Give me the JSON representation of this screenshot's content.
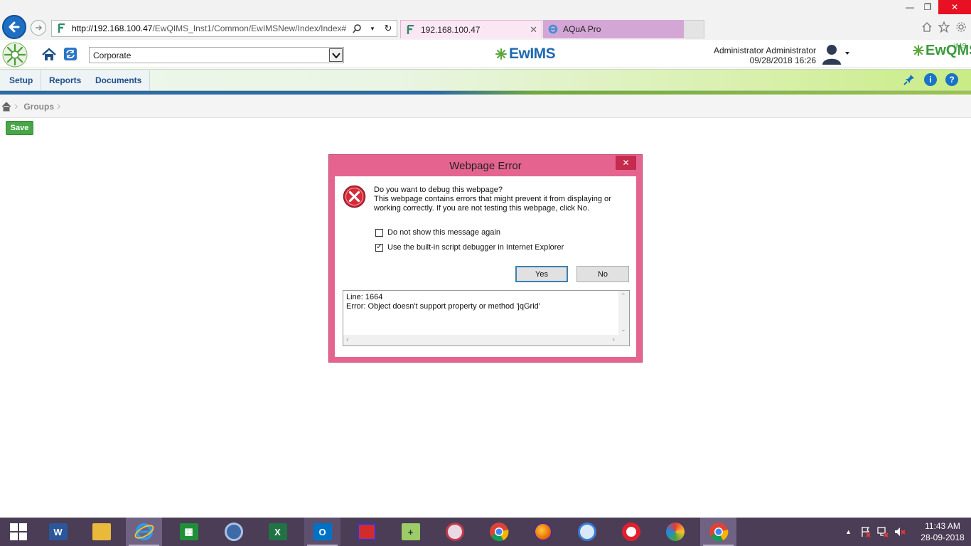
{
  "browser": {
    "address_url_host": "http://192.168.100.47",
    "address_url_path": "/EwQIMS_Inst1/Common/EwIMSNew/Index/Index#",
    "tabs": [
      {
        "label": "192.168.100.47",
        "active": true
      },
      {
        "label": "AQuA Pro",
        "active": false
      }
    ]
  },
  "app_header": {
    "organization_selected": "Corporate",
    "brand_center": "EwIMS",
    "user_name": "Administrator Administrator",
    "datetime": "09/28/2018 16:26",
    "brand_right": "EwQMS",
    "brand_right_sup": "IMS"
  },
  "menu": {
    "items": [
      "Setup",
      "Reports",
      "Documents"
    ]
  },
  "breadcrumb": {
    "current": "Groups"
  },
  "toolbar": {
    "save_label": "Save"
  },
  "dialog": {
    "title": "Webpage Error",
    "close_glyph": "✕",
    "message_line1": "Do you want to debug this webpage?",
    "message_line2": "This webpage contains errors that might prevent it from displaying or",
    "message_line3": "working correctly. If you are not testing this webpage, click No.",
    "checkbox_dont_show": {
      "label": "Do not show this message again",
      "checked": false
    },
    "checkbox_use_debugger": {
      "label": "Use the built-in script debugger in Internet Explorer",
      "checked": true
    },
    "yes_label": "Yes",
    "no_label": "No",
    "details_line1": "Line: 1664",
    "details_line2": "Error: Object doesn't support property or method 'jqGrid'"
  },
  "taskbar": {
    "apps": [
      "start",
      "word",
      "file-explorer",
      "internet-explorer",
      "store",
      "thunderbird",
      "excel",
      "outlook",
      "app-red",
      "notepad-plus",
      "app-snipping",
      "chrome",
      "firefox",
      "safari",
      "opera",
      "paint",
      "chrome-running"
    ],
    "clock_time": "11:43 AM",
    "clock_date": "28-09-2018"
  },
  "colors": {
    "accent_blue": "#1e6fc4",
    "dialog_frame": "#e5648f",
    "save_green": "#48a548",
    "taskbar": "#4a3d55"
  }
}
